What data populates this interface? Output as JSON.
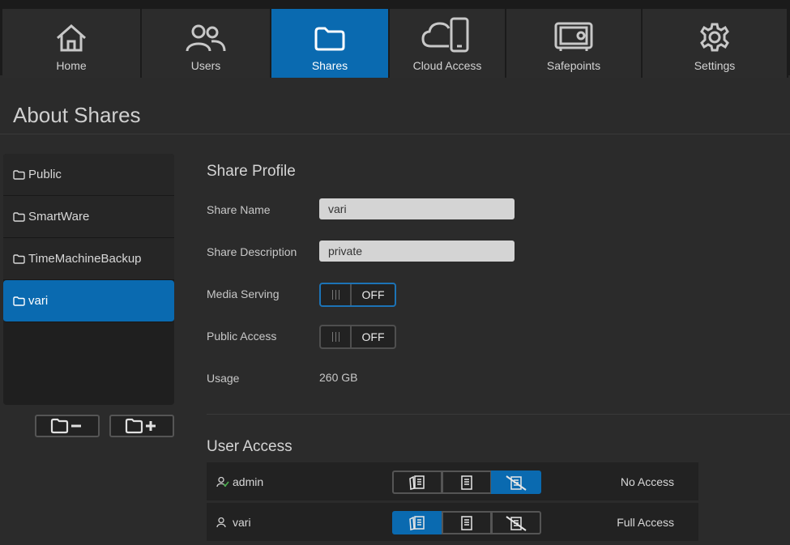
{
  "nav": {
    "items": [
      {
        "label": "Home",
        "icon": "home-icon"
      },
      {
        "label": "Users",
        "icon": "users-icon"
      },
      {
        "label": "Shares",
        "icon": "folder-icon",
        "active": true
      },
      {
        "label": "Cloud Access",
        "icon": "cloud-phone-icon"
      },
      {
        "label": "Safepoints",
        "icon": "safe-icon"
      },
      {
        "label": "Settings",
        "icon": "gear-icon"
      }
    ]
  },
  "page": {
    "title": "About Shares"
  },
  "shares": {
    "items": [
      {
        "label": "Public"
      },
      {
        "label": "SmartWare"
      },
      {
        "label": "TimeMachineBackup"
      },
      {
        "label": "vari",
        "active": true
      }
    ]
  },
  "profile": {
    "title": "Share Profile",
    "share_name_label": "Share Name",
    "share_name_value": "vari",
    "share_desc_label": "Share Description",
    "share_desc_value": "private",
    "media_serving_label": "Media Serving",
    "media_serving_state": "OFF",
    "public_access_label": "Public Access",
    "public_access_state": "OFF",
    "usage_label": "Usage",
    "usage_value": "260 GB"
  },
  "user_access": {
    "title": "User Access",
    "rows": [
      {
        "user": "admin",
        "status": "No Access",
        "selected": "none"
      },
      {
        "user": "vari",
        "status": "Full Access",
        "selected": "full"
      }
    ]
  },
  "colors": {
    "accent": "#0a6ab0",
    "background": "#2b2b2b",
    "nav_bg": "#2c2c2c"
  }
}
